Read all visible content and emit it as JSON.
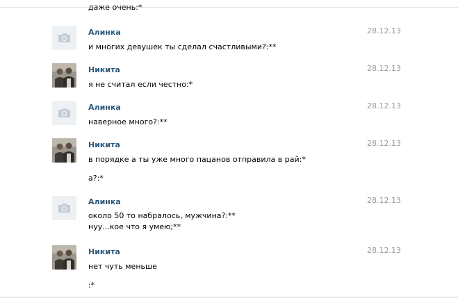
{
  "messages": [
    {
      "type": "continuation",
      "text": "даже очень:*"
    },
    {
      "type": "message",
      "author": "Алинка",
      "date": "28.12.13",
      "avatar": "camera-placeholder-icon",
      "lines": [
        "и многих девушек ты сделал счастливыми?:**"
      ]
    },
    {
      "type": "message",
      "author": "Никита",
      "date": "28.12.13",
      "avatar": "user-photo",
      "lines": [
        "я не считал если честно:*"
      ]
    },
    {
      "type": "message",
      "author": "Алинка",
      "date": "28.12.13",
      "avatar": "camera-placeholder-icon",
      "lines": [
        "наверное много?:**"
      ]
    },
    {
      "type": "message",
      "author": "Никита",
      "date": "28.12.13",
      "avatar": "user-photo",
      "lines": [
        "в порядке а ты уже много пацанов отправила в рай:*",
        "а?:*"
      ]
    },
    {
      "type": "message",
      "author": "Алинка",
      "date": "28.12.13",
      "avatar": "camera-placeholder-icon",
      "lines": [
        "около 50 то набралось, мужчина?:**",
        "нуу...кое что я умею;**"
      ]
    },
    {
      "type": "message",
      "author": "Никита",
      "date": "28.12.13",
      "avatar": "user-photo",
      "lines": [
        "нет чуть меньше",
        ":*"
      ]
    }
  ]
}
